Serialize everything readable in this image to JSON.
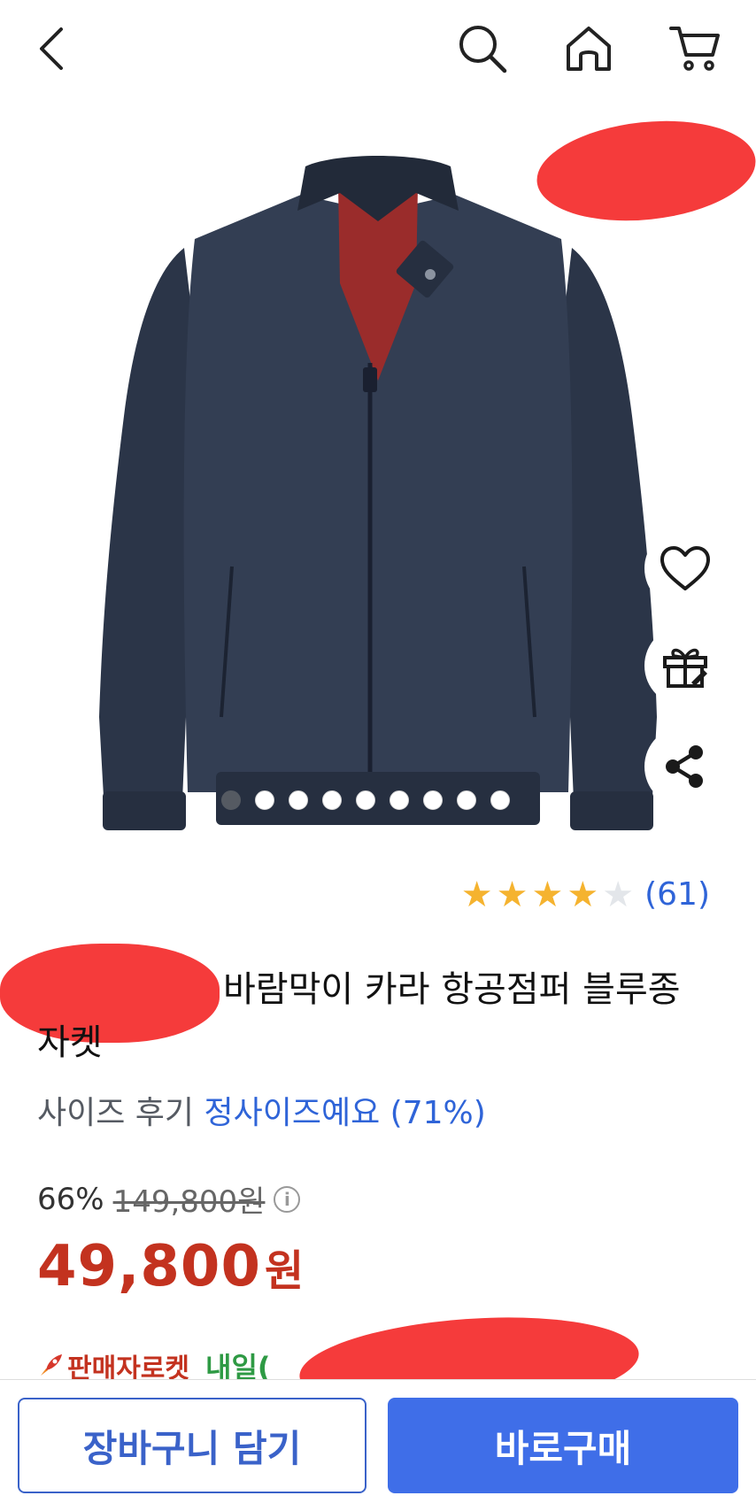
{
  "header": {
    "back_icon": "chevron-left-icon",
    "search_icon": "search-icon",
    "home_icon": "home-icon",
    "cart_icon": "cart-icon"
  },
  "gallery": {
    "image": "navy zip-up bomber jacket",
    "slide_count": 9,
    "current_slide": 1
  },
  "side_actions": {
    "wishlist_icon": "heart-icon",
    "gift_icon": "gift-icon",
    "share_icon": "share-icon"
  },
  "rating": {
    "stars": 4,
    "max_stars": 5,
    "review_count": "(61)"
  },
  "product": {
    "title": "바람막이 카라 항공점퍼 블루종 자켓"
  },
  "size_review": {
    "label": "사이즈 후기",
    "value": "정사이즈예요 (71%)"
  },
  "price": {
    "discount": "66%",
    "original": "149,800원",
    "sale": "49,800",
    "currency": "원"
  },
  "delivery": {
    "badge": "판매자로켓",
    "text": "내일("
  },
  "actions": {
    "add_to_cart": "장바구니 담기",
    "buy_now": "바로구매"
  },
  "colors": {
    "accent_blue": "#3f6ee8",
    "price_red": "#c3321f",
    "delivery_green": "#2e9a44",
    "star": "#f5b32f"
  }
}
